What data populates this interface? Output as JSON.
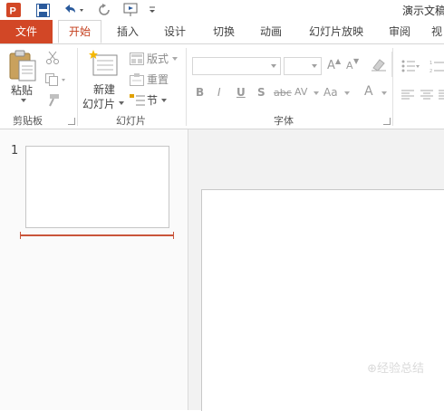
{
  "window": {
    "title": "演示文稿"
  },
  "icons": {
    "app": "powerpoint-logo",
    "save": "save-icon",
    "undo": "undo-icon",
    "redo": "redo-icon",
    "slideshow": "slideshow-start-icon",
    "customize": "customize-qat-icon"
  },
  "tabs": [
    {
      "label": "文件"
    },
    {
      "label": "开始"
    },
    {
      "label": "插入"
    },
    {
      "label": "设计"
    },
    {
      "label": "切换"
    },
    {
      "label": "动画"
    },
    {
      "label": "幻灯片放映"
    },
    {
      "label": "审阅"
    },
    {
      "label": "视"
    }
  ],
  "ribbon": {
    "clipboard": {
      "paste": "粘贴",
      "label": "剪贴板"
    },
    "slides": {
      "new_slide_line1": "新建",
      "new_slide_line2": "幻灯片",
      "layout": "版式",
      "reset": "重置",
      "section": "节",
      "label": "幻灯片"
    },
    "font": {
      "label": "字体",
      "bold": "B",
      "italic": "I",
      "underline": "U",
      "shadow": "S",
      "strike": "abc",
      "spacing": "AV",
      "case": "Aa",
      "color": "A",
      "grow": "A",
      "shrink": "A"
    }
  },
  "thumbnail_pane": {
    "slide_number": "1"
  },
  "colors": {
    "accent": "#d24726",
    "active_tab_text": "#c43e1c",
    "insert_line": "#c9543a"
  },
  "watermark": "⊕经验总结"
}
